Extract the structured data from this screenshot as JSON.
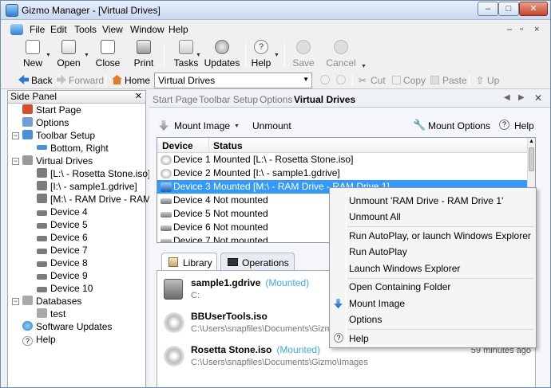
{
  "window": {
    "title": "Gizmo Manager - [Virtual Drives]",
    "buttons": {
      "minimize": "–",
      "maximize": "□",
      "close": "✕"
    }
  },
  "menubar": {
    "items": [
      "File",
      "Edit",
      "Tools",
      "View",
      "Window",
      "Help"
    ],
    "mdi": {
      "minimize": "–",
      "restore": "▫",
      "close": "×"
    }
  },
  "toolbar": {
    "new": "New",
    "open": "Open",
    "close": "Close",
    "print": "Print",
    "tasks": "Tasks",
    "updates": "Updates",
    "help": "Help",
    "save": "Save",
    "cancel": "Cancel"
  },
  "navbar": {
    "back": "Back",
    "forward": "Forward",
    "home": "Home",
    "address": "Virtual Drives",
    "cut": "Cut",
    "copy": "Copy",
    "paste": "Paste",
    "up": "Up"
  },
  "side_panel": {
    "title": "Side Panel",
    "items": [
      {
        "label": "Start Page"
      },
      {
        "label": "Options"
      },
      {
        "label": "Toolbar Setup"
      },
      {
        "label": "Bottom, Right"
      },
      {
        "label": "Virtual Drives"
      },
      {
        "label": "[L:\\ - Rosetta Stone.iso]"
      },
      {
        "label": "[I:\\ - sample1.gdrive]"
      },
      {
        "label": "[M:\\ - RAM Drive - RAM D"
      },
      {
        "label": "Device 4"
      },
      {
        "label": "Device 5"
      },
      {
        "label": "Device 6"
      },
      {
        "label": "Device 7"
      },
      {
        "label": "Device 8"
      },
      {
        "label": "Device 9"
      },
      {
        "label": "Device 10"
      },
      {
        "label": "Databases"
      },
      {
        "label": "test"
      },
      {
        "label": "Software Updates"
      },
      {
        "label": "Help"
      }
    ]
  },
  "tabs": [
    "Start Page",
    "Toolbar Setup",
    "Options",
    "Virtual Drives"
  ],
  "subbar": {
    "mount_image": "Mount Image",
    "unmount": "Unmount",
    "mount_options": "Mount Options",
    "help": "Help"
  },
  "device_list": {
    "headers": {
      "device": "Device",
      "status": "Status"
    },
    "rows": [
      {
        "device": "Device 1",
        "status": "Mounted [L:\\ - Rosetta Stone.iso]"
      },
      {
        "device": "Device 2",
        "status": "Mounted [I:\\ - sample1.gdrive]"
      },
      {
        "device": "Device 3",
        "status": "Mounted [M:\\ - RAM Drive - RAM Drive 1]"
      },
      {
        "device": "Device 4",
        "status": "Not mounted"
      },
      {
        "device": "Device 5",
        "status": "Not mounted"
      },
      {
        "device": "Device 6",
        "status": "Not mounted"
      },
      {
        "device": "Device 7",
        "status": "Not mounted"
      }
    ]
  },
  "panel_tabs": {
    "library": "Library",
    "operations": "Operations"
  },
  "library": [
    {
      "name": "sample1.gdrive",
      "status": "(Mounted)",
      "path": "C:",
      "ago": ""
    },
    {
      "name": "BBUserTools.iso",
      "status": "",
      "path": "C:\\Users\\snapfiles\\Documents\\Gizmo",
      "ago": ""
    },
    {
      "name": "Rosetta Stone.iso",
      "status": "(Mounted)",
      "path": "C:\\Users\\snapfiles\\Documents\\Gizmo\\Images",
      "ago": "59 minutes ago"
    }
  ],
  "context_menu": {
    "items": [
      "Unmount 'RAM Drive - RAM Drive 1'",
      "Unmount All",
      "Run AutoPlay, or launch Windows Explorer",
      "Run AutoPlay",
      "Launch Windows Explorer",
      "Open Containing Folder",
      "Mount Image",
      "Options",
      "Help"
    ]
  }
}
